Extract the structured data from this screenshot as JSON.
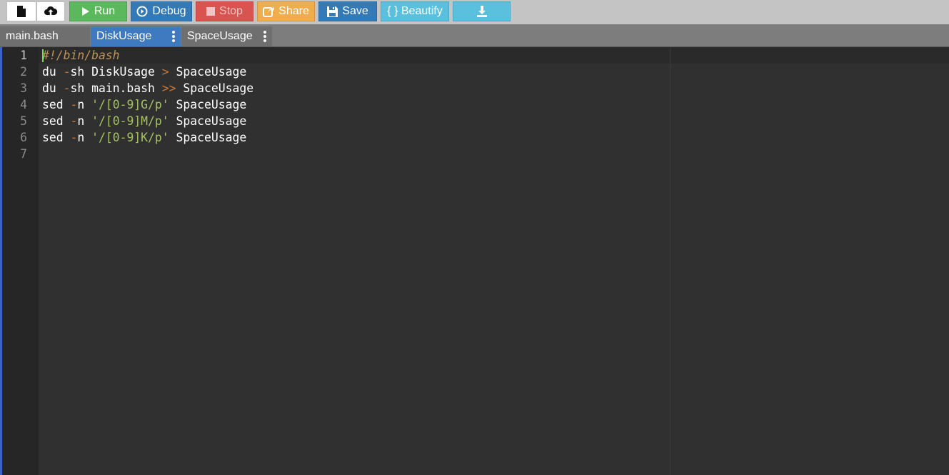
{
  "toolbar": {
    "new_icon": "file-icon",
    "upload_icon": "cloud-upload-icon",
    "run_label": "Run",
    "debug_label": "Debug",
    "stop_label": "Stop",
    "share_label": "Share",
    "save_label": "Save",
    "beautify_label": "{ } Beautify",
    "download_icon": "download-icon"
  },
  "tabs": [
    {
      "label": "main.bash",
      "active": false
    },
    {
      "label": "DiskUsage",
      "active": true
    },
    {
      "label": "SpaceUsage",
      "active": false
    }
  ],
  "editor": {
    "line_numbers": [
      "1",
      "2",
      "3",
      "4",
      "5",
      "6",
      "7"
    ],
    "lines": [
      [
        {
          "t": "#!/bin/bash",
          "c": "comment"
        }
      ],
      [
        {
          "t": "du ",
          "c": "text"
        },
        {
          "t": "-",
          "c": "op"
        },
        {
          "t": "sh DiskUsage ",
          "c": "text"
        },
        {
          "t": ">",
          "c": "op"
        },
        {
          "t": " SpaceUsage",
          "c": "text"
        }
      ],
      [
        {
          "t": "du ",
          "c": "text"
        },
        {
          "t": "-",
          "c": "op"
        },
        {
          "t": "sh main.bash ",
          "c": "text"
        },
        {
          "t": ">>",
          "c": "op"
        },
        {
          "t": " SpaceUsage",
          "c": "text"
        }
      ],
      [
        {
          "t": "sed ",
          "c": "text"
        },
        {
          "t": "-",
          "c": "op"
        },
        {
          "t": "n ",
          "c": "text"
        },
        {
          "t": "'/[0-9]G/p'",
          "c": "str"
        },
        {
          "t": " SpaceUsage",
          "c": "text"
        }
      ],
      [
        {
          "t": "sed ",
          "c": "text"
        },
        {
          "t": "-",
          "c": "op"
        },
        {
          "t": "n ",
          "c": "text"
        },
        {
          "t": "'/[0-9]M/p'",
          "c": "str"
        },
        {
          "t": " SpaceUsage",
          "c": "text"
        }
      ],
      [
        {
          "t": "sed ",
          "c": "text"
        },
        {
          "t": "-",
          "c": "op"
        },
        {
          "t": "n ",
          "c": "text"
        },
        {
          "t": "'/[0-9]K/p'",
          "c": "str"
        },
        {
          "t": " SpaceUsage",
          "c": "text"
        }
      ],
      []
    ]
  },
  "colors": {
    "run": "#5cb85c",
    "debug": "#337ab7",
    "stop": "#d9534f",
    "share": "#f0ad4e",
    "save": "#337ab7",
    "beautify": "#5bc0de",
    "active_tab": "#3f79bf"
  }
}
